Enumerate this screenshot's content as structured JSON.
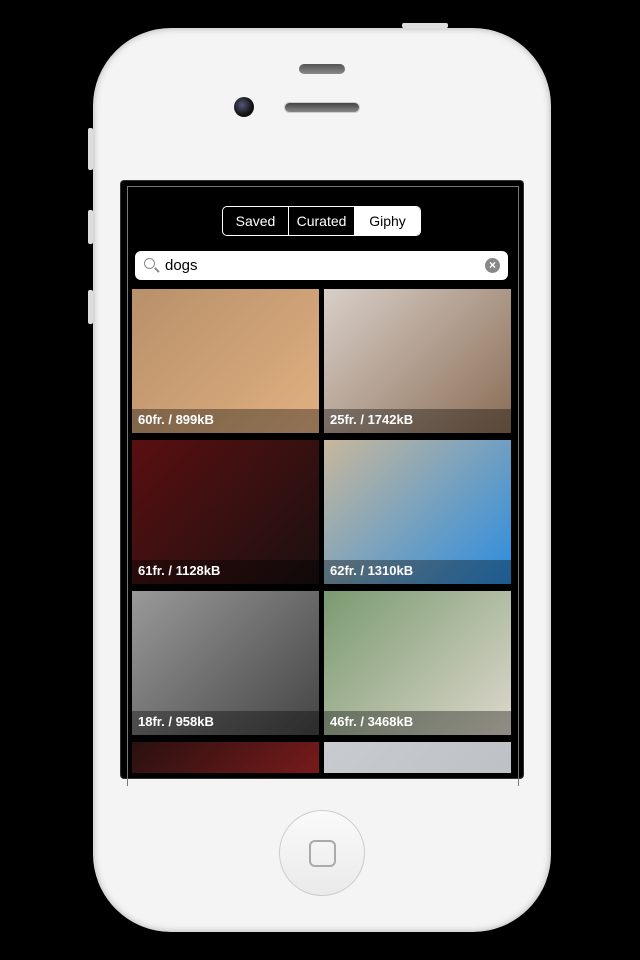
{
  "tabs": [
    {
      "label": "Saved",
      "selected": false
    },
    {
      "label": "Curated",
      "selected": false
    },
    {
      "label": "Giphy",
      "selected": true
    }
  ],
  "search": {
    "value": "dogs",
    "icon": "search-icon",
    "clear_icon": "clear-icon"
  },
  "results": [
    {
      "caption": "60fr. / 899kB",
      "colors": [
        "#b8906a",
        "#e0b080"
      ]
    },
    {
      "caption": "25fr. / 1742kB",
      "colors": [
        "#d8cfc8",
        "#8a6d55"
      ]
    },
    {
      "caption": "61fr. / 1128kB",
      "colors": [
        "#5a0f10",
        "#1a1010"
      ]
    },
    {
      "caption": "62fr. / 1310kB",
      "colors": [
        "#c8b89c",
        "#2a8ce0"
      ]
    },
    {
      "caption": "18fr. / 958kB",
      "colors": [
        "#999",
        "#444"
      ]
    },
    {
      "caption": "46fr. / 3468kB",
      "colors": [
        "#7a9a70",
        "#ddd8cc"
      ]
    },
    {
      "caption": "",
      "colors": [
        "#2a1010",
        "#a02020"
      ]
    },
    {
      "caption": "",
      "colors": [
        "#c8ccd0",
        "#b8bcc0"
      ]
    }
  ]
}
